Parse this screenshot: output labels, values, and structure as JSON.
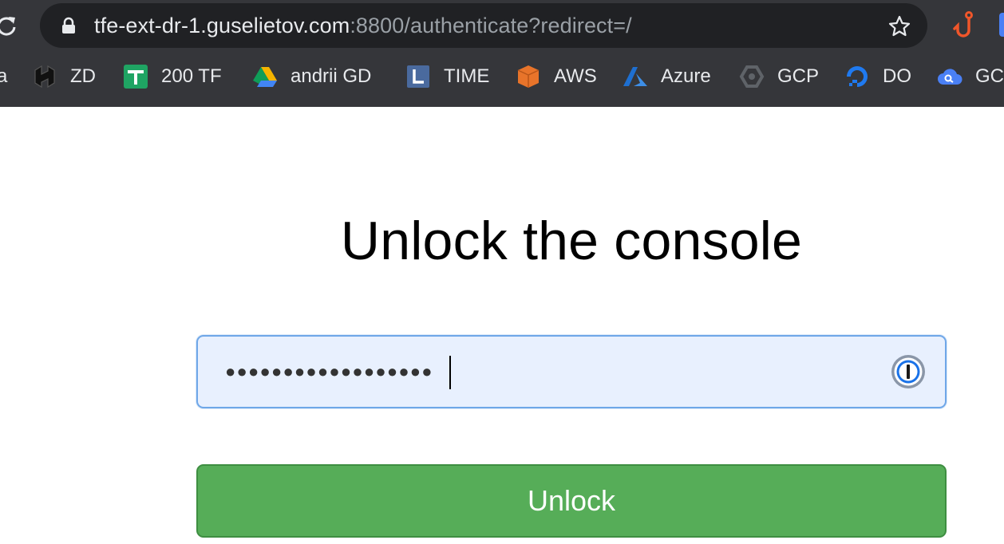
{
  "browser": {
    "url_host": "tfe-ext-dr-1.guselietov.com",
    "url_rest": ":8800/authenticate?redirect=/",
    "bookmarks": [
      {
        "label": "a",
        "icon": "bookmark-icon"
      },
      {
        "label": "ZD",
        "icon": "hashicorp-icon"
      },
      {
        "label": "200 TF",
        "icon": "sheets-plus-icon"
      },
      {
        "label": "andrii  GD",
        "icon": "google-drive-icon"
      },
      {
        "label": "TIME",
        "icon": "clock-icon"
      },
      {
        "label": "AWS",
        "icon": "aws-cube-icon"
      },
      {
        "label": "Azure",
        "icon": "azure-icon"
      },
      {
        "label": "GCP",
        "icon": "gcp-hexagon-icon"
      },
      {
        "label": "DO",
        "icon": "digitalocean-icon"
      },
      {
        "label": "GC",
        "icon": "cloud-search-icon"
      }
    ]
  },
  "page": {
    "title": "Unlock the console",
    "password_mask": "●●●●●●●●●●●●●●●●●●",
    "unlock_label": "Unlock"
  },
  "colors": {
    "chrome_bg": "#35363a",
    "omnibox_bg": "#202124",
    "input_bg": "#e8f0fe",
    "input_border": "#6fa7e8",
    "button_bg": "#56ad58",
    "button_border": "#3e8e41"
  }
}
